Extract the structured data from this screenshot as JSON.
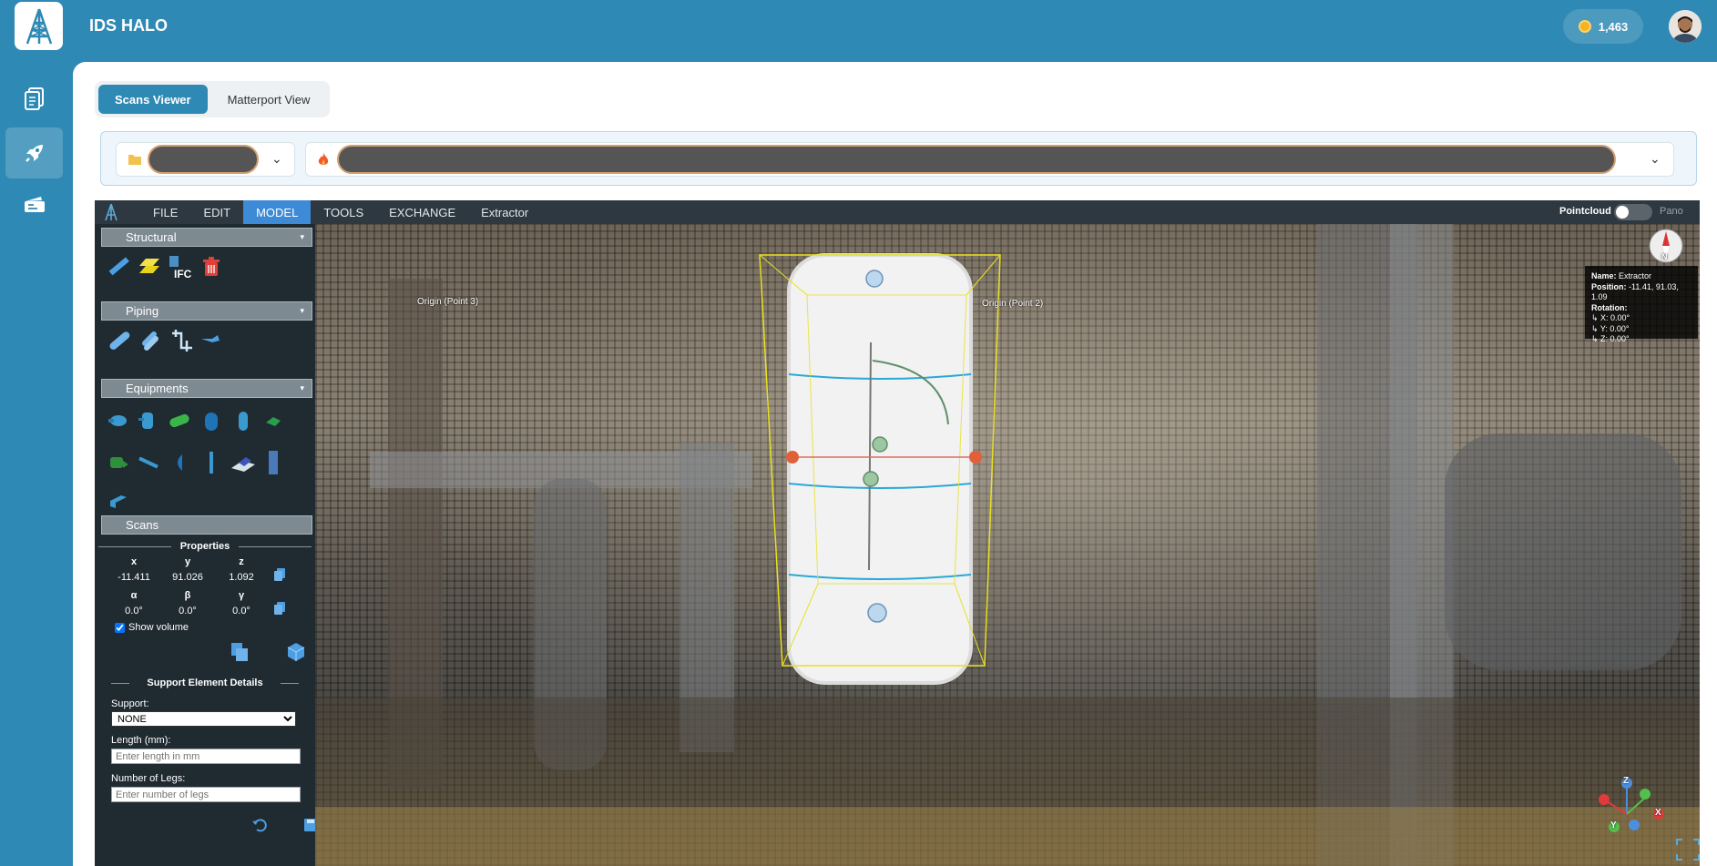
{
  "app": {
    "title": "IDS HALO",
    "coins": "1,463"
  },
  "tabs": [
    {
      "label": "Scans Viewer",
      "active": true
    },
    {
      "label": "Matterport View",
      "active": false
    }
  ],
  "menu": {
    "items": [
      "FILE",
      "EDIT",
      "MODEL",
      "TOOLS",
      "EXCHANGE",
      "Extractor"
    ],
    "active": "MODEL",
    "pointcloud_label": "Pointcloud",
    "pano_label": "Pano"
  },
  "sidebar": {
    "sections": {
      "structural": "Structural",
      "piping": "Piping",
      "equipments": "Equipments",
      "scans": "Scans"
    },
    "properties": {
      "title": "Properties",
      "x_label": "x",
      "y_label": "y",
      "z_label": "z",
      "x": "-11.411",
      "y": "91.026",
      "z": "1.092",
      "alpha_label": "α",
      "beta_label": "β",
      "gamma_label": "γ",
      "alpha": "0.0°",
      "beta": "0.0°",
      "gamma": "0.0°",
      "show_volume": "Show volume"
    },
    "support": {
      "title": "Support Element Details",
      "support_label": "Support:",
      "support_value": "NONE",
      "length_label": "Length (mm):",
      "length_placeholder": "Enter length in mm",
      "legs_label": "Number of Legs:",
      "legs_placeholder": "Enter number of legs"
    }
  },
  "scene": {
    "origin_point_3": "Origin (Point 3)",
    "origin_point_2": "Origin (Point 2)",
    "info": {
      "name_label": "Name:",
      "name": "Extractor",
      "position_label": "Position:",
      "position": "-11.41, 91.03, 1.09",
      "rotation_label": "Rotation:",
      "rx": "↳ X: 0.00°",
      "ry": "↳ Y: 0.00°",
      "rz": "↳ Z: 0.00°"
    },
    "gizmo": {
      "z": "Z",
      "y": "Y",
      "x": "X"
    },
    "compass": "N"
  },
  "colors": {
    "brand": "#2e89b4",
    "menu_active": "#3d8ad6",
    "bbox": "#e8e020"
  }
}
